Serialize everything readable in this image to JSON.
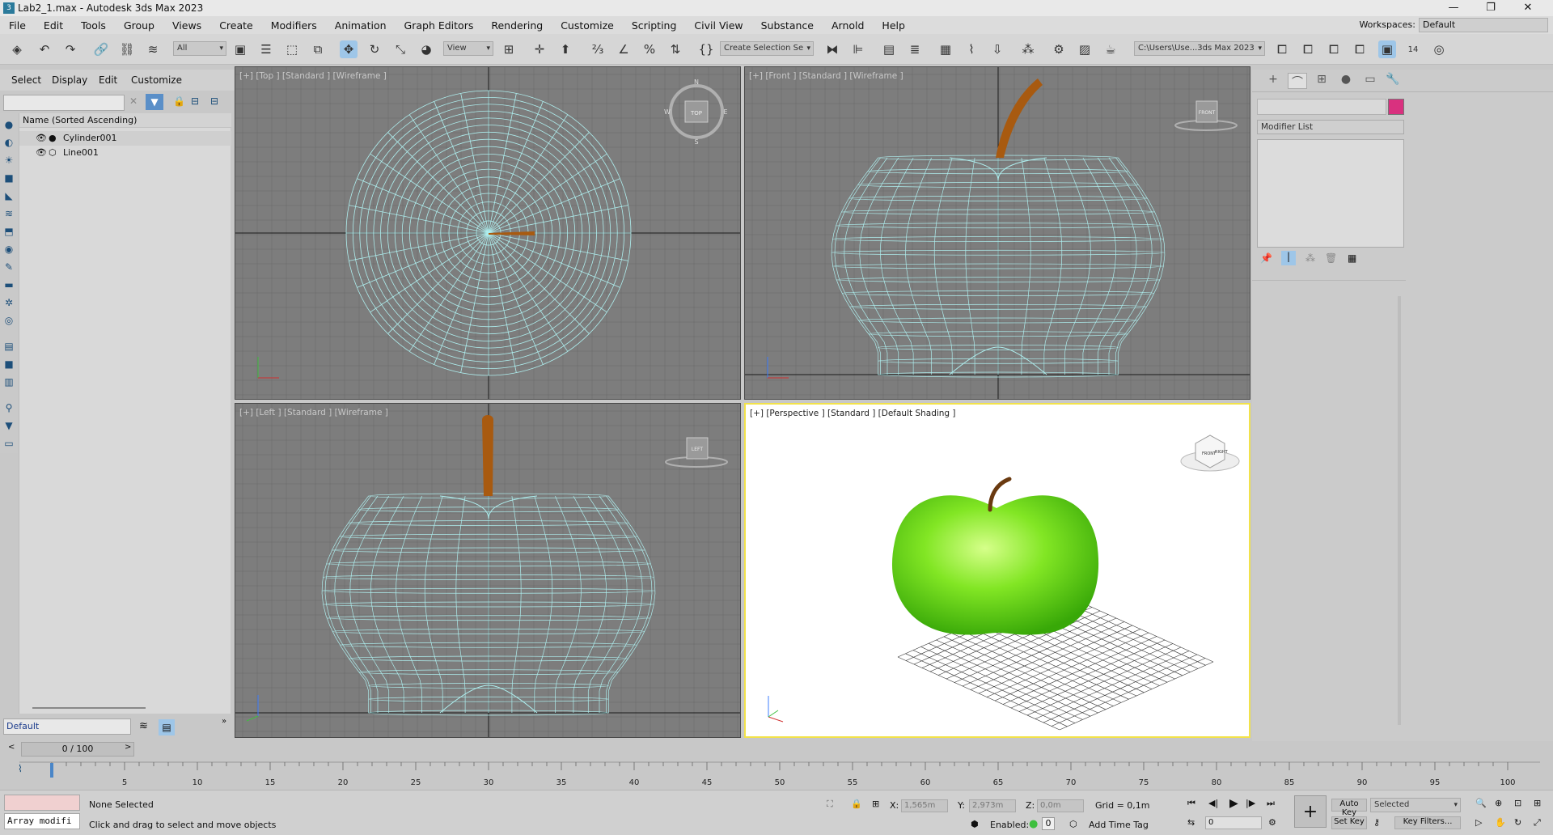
{
  "window": {
    "title": "Lab2_1.max - Autodesk 3ds Max 2023",
    "controls": [
      "—",
      "❐",
      "✕"
    ]
  },
  "menu": [
    "File",
    "Edit",
    "Tools",
    "Group",
    "Views",
    "Create",
    "Modifiers",
    "Animation",
    "Graph Editors",
    "Rendering",
    "Customize",
    "Scripting",
    "Civil View",
    "Substance",
    "Arnold",
    "Help"
  ],
  "workspaces": {
    "label": "Workspaces:",
    "value": "Default"
  },
  "toolbar": {
    "filter_value": "All",
    "ref_coord": "View",
    "selection_set": "Create Selection Se",
    "project_path": "C:\\Users\\Use...3ds Max 2023",
    "frame_counter": "14"
  },
  "scene_explorer": {
    "tabs": [
      "Select",
      "Display",
      "Edit",
      "Customize"
    ],
    "header": "Name (Sorted Ascending)",
    "objects": [
      "Cylinder001",
      "Line001"
    ],
    "layer": "Default"
  },
  "viewports": {
    "top": {
      "label": "[+] [Top ] [Standard ] [Wireframe ]",
      "cube": "TOP",
      "compass": {
        "n": "N",
        "s": "S",
        "w": "W",
        "e": "E"
      }
    },
    "front": {
      "label": "[+] [Front ] [Standard ] [Wireframe ]",
      "cube": "FRONT"
    },
    "left": {
      "label": "[+] [Left ] [Standard ] [Wireframe ]",
      "cube": "LEFT"
    },
    "perspective": {
      "label": "[+] [Perspective ] [Standard ] [Default Shading ]",
      "cube_faces": [
        "FRONT",
        "RIGHT"
      ]
    },
    "colors": {
      "wire": "#aeeeee",
      "stem": "#a85a10",
      "apple": "#7ee020",
      "grid": "#7d7d7d",
      "active_border": "#f2e24a"
    }
  },
  "command_panel": {
    "modifier_list": "Modifier List",
    "object_color": "#d9317f"
  },
  "timeline": {
    "slider": "0 / 100",
    "ticks": [
      "5",
      "10",
      "15",
      "20",
      "25",
      "30",
      "35",
      "40",
      "45",
      "50",
      "55",
      "60",
      "65",
      "70",
      "75",
      "80",
      "85",
      "90",
      "95",
      "100"
    ]
  },
  "status": {
    "selection": "None Selected",
    "prompt": "Click and drag to select and move objects",
    "maxscript": "Array modifi",
    "x_label": "X:",
    "x_value": "1,565m",
    "y_label": "Y:",
    "y_value": "2,973m",
    "z_label": "Z:",
    "z_value": "0,0m",
    "grid": "Grid = 0,1m",
    "enabled_label": "Enabled:",
    "enabled_value": "0",
    "add_time_tag": "Add Time Tag",
    "auto_key": "Auto Key",
    "set_key": "Set Key",
    "key_mode": "Selected",
    "key_filters": "Key Filters...",
    "frame": "0"
  }
}
